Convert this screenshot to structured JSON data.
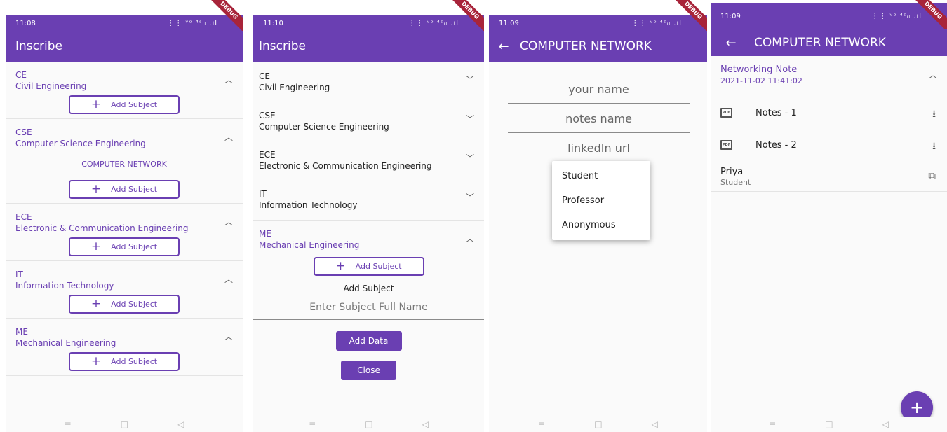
{
  "colors": {
    "primary": "#6a3fb2",
    "debug": "#a8243a"
  },
  "debug_label": "DEBUG",
  "nav": {
    "menu": "≡",
    "home": "□",
    "back": "◁"
  },
  "screen1": {
    "time": "11:08",
    "status_right": "⋮⋮ ᵛᵒ ⁴ˢᵢₗ .ıl",
    "title": "Inscribe",
    "add_label": "Add Subject",
    "sections": [
      {
        "code": "CE",
        "name": "Civil Engineering"
      },
      {
        "code": "CSE",
        "name": "Computer Science Engineering",
        "subject": "COMPUTER NETWORK"
      },
      {
        "code": "ECE",
        "name": "Electronic & Communication Engineering"
      },
      {
        "code": "IT",
        "name": "Information Technology"
      },
      {
        "code": "ME",
        "name": "Mechanical Engineering"
      }
    ]
  },
  "screen2": {
    "time": "11:10",
    "status_right": "⋮⋮ ᵛᵒ ⁴ˢᵢₗ .ıl",
    "title": "Inscribe",
    "sections": [
      {
        "code": "CE",
        "name": "Civil Engineering"
      },
      {
        "code": "CSE",
        "name": "Computer Science Engineering"
      },
      {
        "code": "ECE",
        "name": "Electronic & Communication Engineering"
      },
      {
        "code": "IT",
        "name": "Information Technology"
      },
      {
        "code": "ME",
        "name": "Mechanical Engineering"
      }
    ],
    "add_label": "Add Subject",
    "form_title": "Add Subject",
    "input_placeholder": "Enter Subject Full Name",
    "add_data": "Add Data",
    "close": "Close"
  },
  "screen3": {
    "time": "11:09",
    "status_right": "⋮⋮ ᵛᵒ ⁴ˢᵢₗ .ıl",
    "title": "COMPUTER NETWORK",
    "name_placeholder": "your name",
    "notes_placeholder": "notes name",
    "linkedin_placeholder": "linkedIn url",
    "options": [
      "Student",
      "Professor",
      "Anonymous"
    ]
  },
  "screen4": {
    "time": "11:09",
    "status_right": "⋮⋮ ᵛᵒ ⁴ˢᵢₗ .ıl",
    "title": "COMPUTER NETWORK",
    "note_title": "Networking Note",
    "note_date": "2021-11-02 11:41:02",
    "pdf_label": "PDF",
    "files": [
      "Notes - 1",
      "Notes - 2"
    ],
    "person_name": "Priya",
    "person_role": "Student",
    "fab": "+"
  }
}
